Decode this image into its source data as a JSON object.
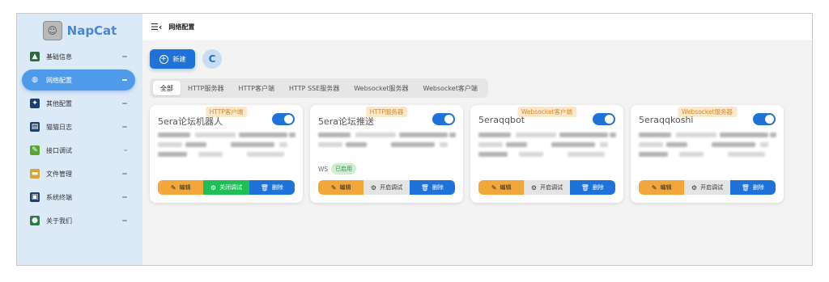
{
  "brand": {
    "title": "NapCat",
    "logo_icon": "cat-logo-icon"
  },
  "sidebar": {
    "items": [
      {
        "label": "基础信息",
        "icon": "info-icon",
        "color": "#2d6b3a",
        "glyph": "▲"
      },
      {
        "label": "网络配置",
        "icon": "network-icon",
        "color": "#ffffff",
        "glyph": "◍",
        "active": true
      },
      {
        "label": "其他配置",
        "icon": "gear-icon",
        "color": "#1d3f6e",
        "glyph": "✦"
      },
      {
        "label": "猫猫日志",
        "icon": "log-icon",
        "color": "#1d3f6e",
        "glyph": "▤"
      },
      {
        "label": "接口调试",
        "icon": "debug-icon",
        "color": "#5aa52f",
        "glyph": "✎",
        "chevron": true
      },
      {
        "label": "文件管理",
        "icon": "folder-icon",
        "color": "#d6a437",
        "glyph": "▬"
      },
      {
        "label": "系统终端",
        "icon": "terminal-icon",
        "color": "#1d3f6e",
        "glyph": "▣"
      },
      {
        "label": "关于我们",
        "icon": "about-icon",
        "color": "#2b7a4a",
        "glyph": "●"
      }
    ]
  },
  "header": {
    "menu_icon": "☰‹",
    "title": "网络配置"
  },
  "actions": {
    "new_label": "新建",
    "refresh_icon": "C"
  },
  "tabs": [
    "全部",
    "HTTP服务器",
    "HTTP客户端",
    "HTTP SSE服务器",
    "Websocket服务器",
    "Websocket客户端"
  ],
  "cards": [
    {
      "name": "5era论坛机器人",
      "tag": "HTTP客户端",
      "enabled": true,
      "debug_label": "关闭调试",
      "debug_on": true
    },
    {
      "name": "5era论坛推送",
      "tag": "HTTP服务器",
      "enabled": true,
      "debug_label": "开启调试",
      "debug_on": false,
      "ws": "WS",
      "ws_status": "已启用"
    },
    {
      "name": "5eraqqbot",
      "tag": "Websocket客户端",
      "enabled": true,
      "debug_label": "开启调试",
      "debug_on": false
    },
    {
      "name": "5eraqqkoshi",
      "tag": "Websocket服务器",
      "enabled": true,
      "debug_label": "开启调试",
      "debug_on": false
    }
  ],
  "card_buttons": {
    "edit": "编辑",
    "delete": "删除"
  },
  "colors": {
    "accent": "#1f73d8",
    "sidebar_bg": "#dceaf8",
    "edit": "#f3a73a",
    "debug_on": "#1fbf55"
  }
}
